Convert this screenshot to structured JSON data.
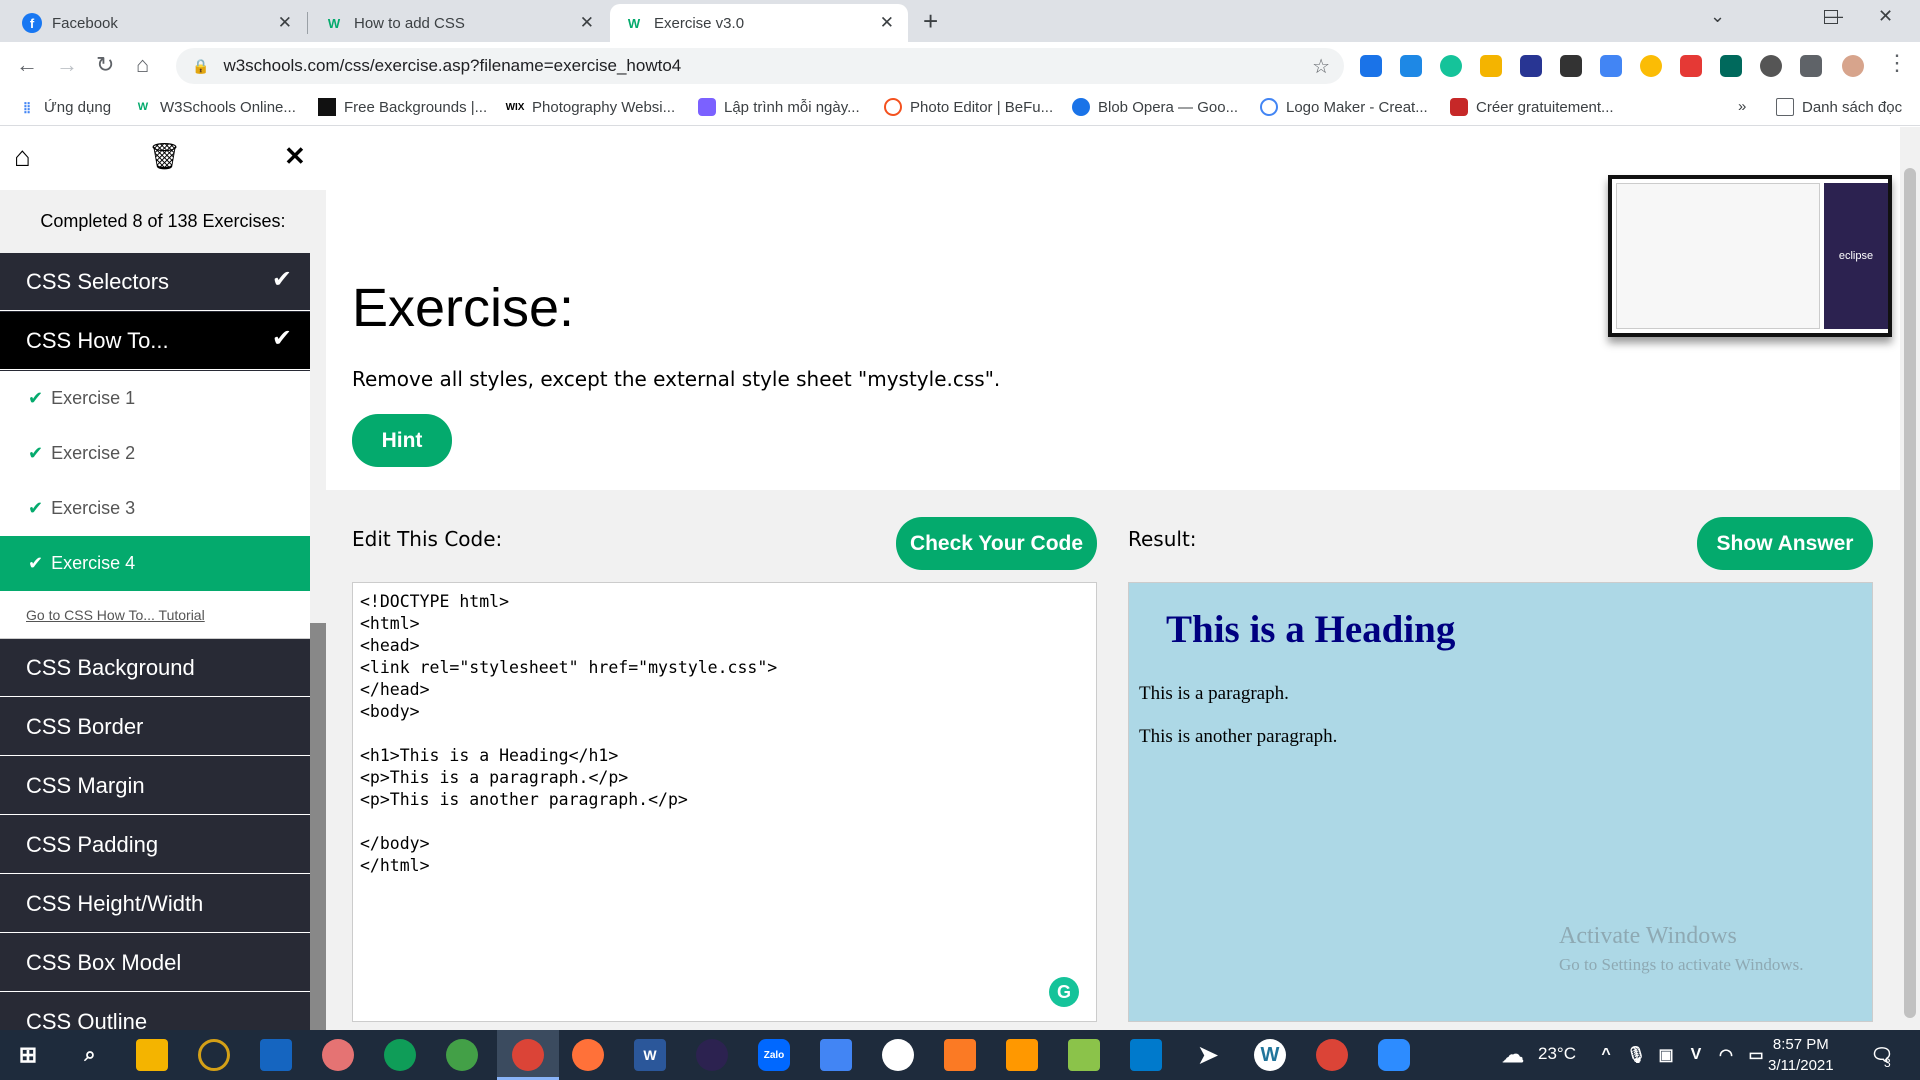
{
  "tabs": [
    {
      "title": "Facebook",
      "icon": "facebook-icon",
      "color": "#1877f2"
    },
    {
      "title": "How to add CSS",
      "icon": "w3schools-icon",
      "color": "#04aa6d"
    },
    {
      "title": "Exercise v3.0",
      "icon": "w3schools-icon",
      "color": "#04aa6d"
    }
  ],
  "address": {
    "url": "w3schools.com/css/exercise.asp?filename=exercise_howto4"
  },
  "bookmarks": [
    {
      "label": "Ứng dụng"
    },
    {
      "label": "W3Schools Online..."
    },
    {
      "label": "Free Backgrounds |..."
    },
    {
      "label": "Photography Websi..."
    },
    {
      "label": "Lập trình mỗi ngày..."
    },
    {
      "label": "Photo Editor | BeFu..."
    },
    {
      "label": "Blob Opera — Goo..."
    },
    {
      "label": "Logo Maker - Creat..."
    },
    {
      "label": "Créer gratuitement..."
    }
  ],
  "bookmarks_more": "»",
  "reading_list": "Danh sách đọc",
  "sidebar": {
    "completed": "Completed 8 of 138 Exercises:",
    "sections_top": [
      "CSS Selectors",
      "CSS How To..."
    ],
    "exercises": [
      "Exercise 1",
      "Exercise 2",
      "Exercise 3",
      "Exercise 4"
    ],
    "tutorial_link": "Go to CSS How To... Tutorial",
    "sections_bottom": [
      "CSS Background",
      "CSS Border",
      "CSS Margin",
      "CSS Padding",
      "CSS Height/Width",
      "CSS Box Model",
      "CSS Outline"
    ]
  },
  "main": {
    "title": "Exercise:",
    "instruction": "Remove all styles, except the external style sheet \"mystyle.css\".",
    "hint": "Hint",
    "edit_label": "Edit This Code:",
    "check": "Check Your Code",
    "result_label": "Result:",
    "show_answer": "Show Answer",
    "code": "<!DOCTYPE html>\n<html>\n<head>\n<link rel=\"stylesheet\" href=\"mystyle.css\">\n</head>\n<body>\n\n<h1>This is a Heading</h1>\n<p>This is a paragraph.</p>\n<p>This is another paragraph.</p>\n\n</body>\n</html>",
    "result_heading": "This is a Heading",
    "result_p1": "This is a paragraph.",
    "result_p2": "This is another paragraph.",
    "ad_brand": "eclipse"
  },
  "watermark": {
    "line1": "Activate Windows",
    "line2": "Go to Settings to activate Windows."
  },
  "taskbar": {
    "temperature": "23°C",
    "time": "8:57 PM",
    "date": "3/11/2021",
    "notifications": "3"
  },
  "colors": {
    "accent": "#04aa6d",
    "sidebar": "#282a35",
    "result_bg": "#add8e6",
    "heading": "#000080"
  }
}
